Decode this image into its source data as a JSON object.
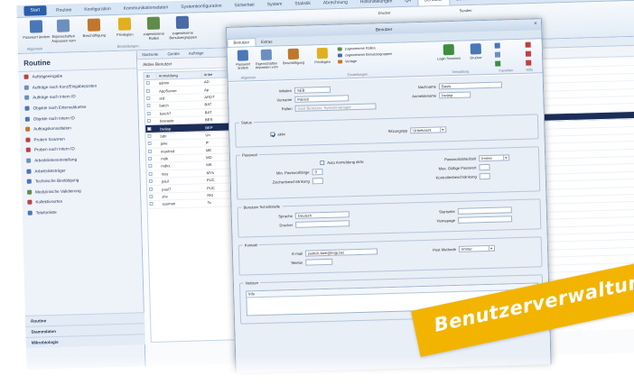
{
  "app": {
    "ribbon_tabs": [
      "Start",
      "Routine",
      "Konfiguration",
      "Kommunikationsdaten",
      "Systemkonfiguration",
      "Sicherheit",
      "System",
      "Statistik",
      "Abrechnung",
      "Hilfsmittelungen",
      "Q4",
      "Benutzer",
      "Benutze"
    ],
    "ribbon_buttons": [
      {
        "label": "Passwort ändern",
        "icon": "screen-icon",
        "color": "#4a77b8"
      },
      {
        "label": "Eigenschaften Anpassen vom",
        "icon": "properties-icon",
        "color": "#6d8fbf"
      },
      {
        "label": "Beschäftigung",
        "icon": "users-icon",
        "color": "#c0772c"
      },
      {
        "label": "Privilegien",
        "icon": "key-icon",
        "color": "#e0b020"
      },
      {
        "label": "zugewiesene Rollen",
        "icon": "roles-icon",
        "color": "#5f8c4a"
      },
      {
        "label": "zugewiesene Benutzergruppen",
        "icon": "group-icon",
        "color": "#4a6aa8"
      }
    ],
    "ribbon_groups": [
      "Allgemein",
      "Einstellungen"
    ],
    "ribbon_right": [
      "Drucker",
      "Senden"
    ]
  },
  "sidebar": {
    "title": "Routine",
    "items": [
      {
        "label": "Aufträgeeingabe",
        "color": "#c04040"
      },
      {
        "label": "Aufträge nach Kurz/Eingabeposten",
        "color": "#6d8fbf"
      },
      {
        "label": "Aufträge nach Intern ID",
        "color": "#6d8fbf"
      },
      {
        "label": "Objekte nach Externalduetse",
        "color": "#4a77b8"
      },
      {
        "label": "Objekte nach Intern ID",
        "color": "#4a77b8"
      },
      {
        "label": "Auftragskonsultation",
        "color": "#c0772c"
      },
      {
        "label": "Proben Scannen",
        "color": "#c04040"
      },
      {
        "label": "Proben nach Intern ID",
        "color": "#c04040"
      },
      {
        "label": "Arbeitslisteneinstellung",
        "color": "#6d8fbf"
      },
      {
        "label": "Arbeitsliststräger",
        "color": "#4a77b8"
      },
      {
        "label": "Technische Bestätigung",
        "color": "#4a77b8"
      },
      {
        "label": "Medizinische Validierung",
        "color": "#5f8c4a"
      },
      {
        "label": "Kollektivsortes",
        "color": "#c04040"
      },
      {
        "label": "Telefonliste",
        "color": "#4a77b8"
      }
    ],
    "footer": [
      "Routine",
      "Stammdaten",
      "Mikrobiologie"
    ]
  },
  "center": {
    "subtabs": [
      "Startseite",
      "Geräte",
      "Aufträge"
    ],
    "crumb": "Aktive Benutzer",
    "grid_headers": [
      "ID",
      "Anmeldung",
      "Anbe"
    ],
    "rows": [
      [
        "admin",
        "AD"
      ],
      [
        "AppServer",
        "Ap"
      ],
      [
        "ard",
        "ARDT"
      ],
      [
        "batch",
        "BAT"
      ],
      [
        "batch7",
        "BAT"
      ],
      [
        "bewaste",
        "BES"
      ],
      [
        "bwäsp",
        "BEP"
      ],
      [
        "bdn",
        "Un"
      ],
      [
        "jane",
        "je"
      ],
      [
        "manfred",
        "ME"
      ],
      [
        "mdk",
        "MD"
      ],
      [
        "mdkx",
        "MK"
      ],
      [
        "mxy",
        "MYs"
      ],
      [
        "paul",
        "PUC"
      ],
      [
        "paul7",
        "PUC"
      ],
      [
        "shv",
        "RKI"
      ],
      [
        "susman",
        "Ts"
      ]
    ],
    "selected_row": 6
  },
  "dialog": {
    "title": "Benutzer",
    "close": "✕",
    "tabs": [
      "Benutzer",
      "Extras"
    ],
    "ribbon_buttons": [
      {
        "label": "Passwort ändern",
        "icon": "screen-icon",
        "color": "#4a77b8"
      },
      {
        "label": "Eigenschaften Anpassen vom",
        "icon": "properties-icon",
        "color": "#6d8fbf"
      },
      {
        "label": "Beschäftigung",
        "icon": "users-icon",
        "color": "#c0772c"
      },
      {
        "label": "Privilegien",
        "icon": "key-icon",
        "color": "#e0b020"
      }
    ],
    "ribbon_lines": [
      "zugewiesene Rollen",
      "zugewiesene Benutzergruppen",
      "Verlage"
    ],
    "ribbon_right": [
      {
        "label": "Login Sessions",
        "icon": "login-icon",
        "color": "#3d8f3d"
      },
      {
        "label": "Drucker",
        "icon": "printer-icon",
        "color": "#4a77b8"
      }
    ],
    "ribbon_groups": [
      "Allgemein",
      "Einstellungen",
      "Verwaltung",
      "Favoriten",
      "Hilfe"
    ],
    "fields": {
      "initialen_label": "Initialen",
      "initialen_value": "SEB",
      "nachname_label": "Nachname",
      "nachname_value": "Basis",
      "vorname_label": "Vorname",
      "vorname_value": "Patrick",
      "anmeldename_label": "Anmeldename",
      "anmeldename_value": "bwäsp",
      "rollen_label": "Rollen",
      "rollen_value": "Gost Benutzer, Systemmanager"
    },
    "status": {
      "title": "Status",
      "aktiv_label": "aktiv",
      "sitzungstyp_label": "Sitzungstyp",
      "sitzungstyp_value": "Unbekannt"
    },
    "passwort": {
      "title": "Passwort",
      "auto_label": "Auto Anmeldung aktiv",
      "ablaufzeit_label": "Passwortablaufzeit",
      "ablaufzeit_value": "Immer",
      "min_laenge_label": "Min. Passwortlänge",
      "min_laenge_value": "0",
      "gueltig_label": "Max. Gültige Passwort",
      "zeichen_label": "Zeichenbeschränkung",
      "kontrollen_label": "Kontrollenbeschränkung"
    },
    "schnittstelle": {
      "title": "Benutzer Schnittstelle",
      "sprache_label": "Sprache",
      "sprache_value": "Deutsch",
      "startseite_label": "Startseite",
      "drucker_label": "Drucker",
      "homepage_label": "Homepage"
    },
    "kontakt": {
      "title": "Kontakt",
      "email_label": "E-mail",
      "email_value": "patrick.bwe@lmjp.bei",
      "telefon_label": "Telefon",
      "postmethode_label": "Post Methode",
      "postmethode_value": "Immer"
    },
    "notizen": {
      "title": "Notizen",
      "head": "Info"
    }
  },
  "banner": {
    "text": "Benutzerverwaltung",
    "color": "#f2b400"
  }
}
